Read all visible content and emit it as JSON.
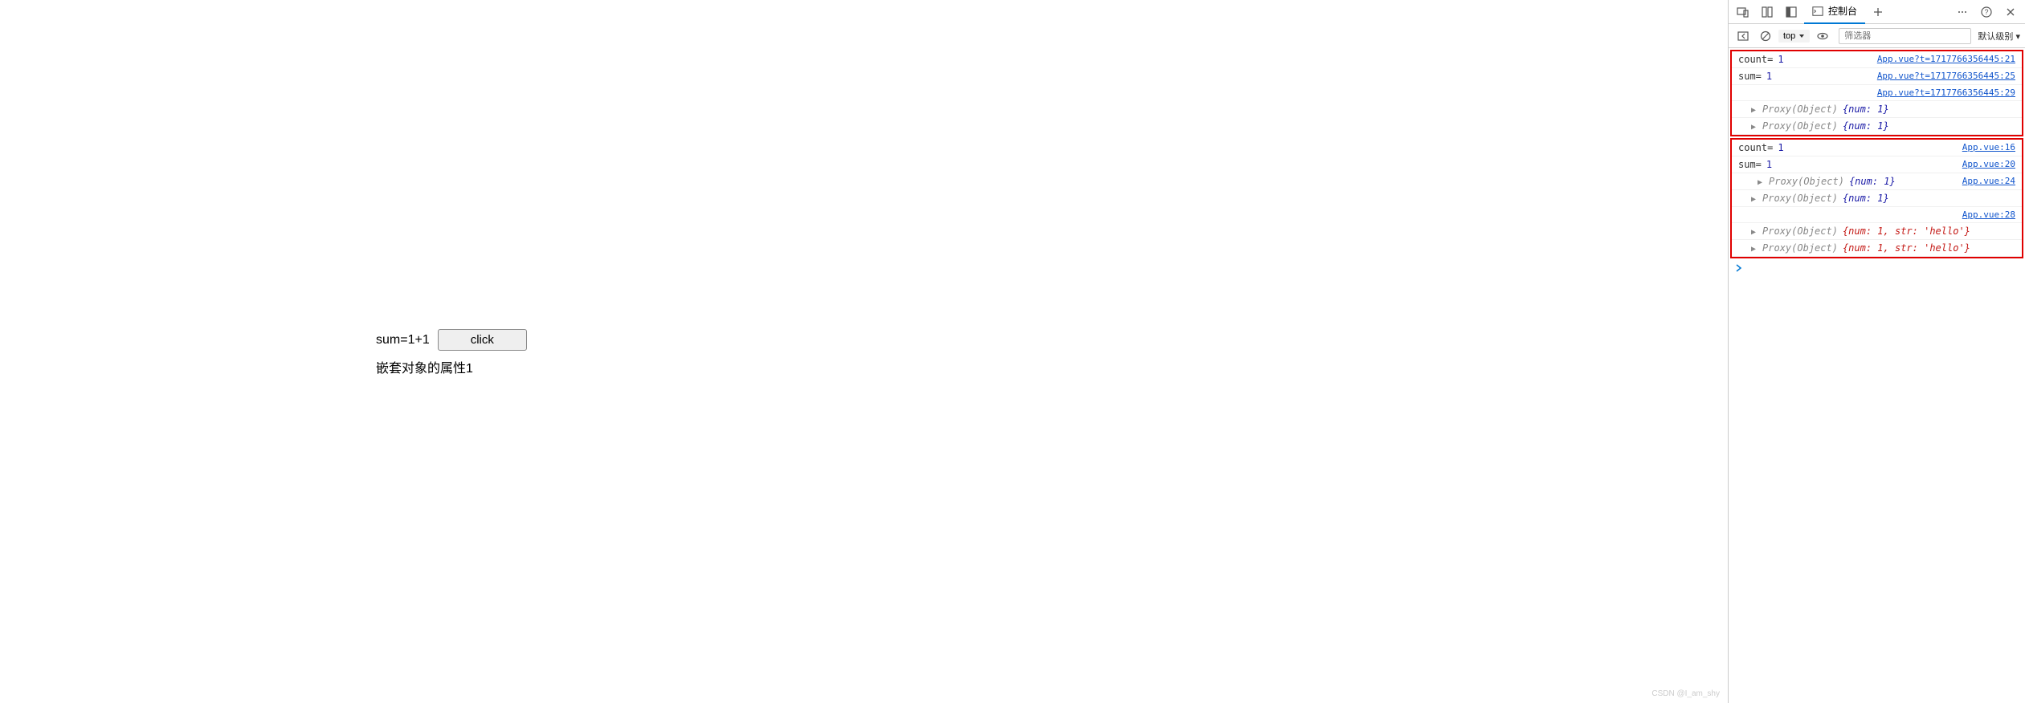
{
  "main": {
    "sum_line": "sum=1+1",
    "button_label": "click",
    "nested_line": "嵌套对象的属性1"
  },
  "devtools": {
    "tabs": {
      "console_label": "控制台"
    },
    "toolbar": {
      "context": "top",
      "filter_placeholder": "筛选器",
      "level": "默认级别"
    },
    "logs_group1": [
      {
        "label": "count=",
        "value": "1",
        "src": "App.vue?t=1717766356445:21"
      },
      {
        "label": "sum=",
        "value": "1",
        "src": "App.vue?t=1717766356445:25"
      }
    ],
    "group1_src3": "App.vue?t=1717766356445:29",
    "group1_proxy": [
      {
        "prefix": "Proxy(Object)",
        "body": "{num: 1}"
      },
      {
        "prefix": "Proxy(Object)",
        "body": "{num: 1}"
      }
    ],
    "logs_group2": [
      {
        "label": "count=",
        "value": "1",
        "src": "App.vue:16"
      },
      {
        "label": "sum=",
        "value": "1",
        "src": "App.vue:20"
      }
    ],
    "group2_proxy1_src": "App.vue:24",
    "group2_proxy1": [
      {
        "prefix": "Proxy(Object)",
        "body": "{num: 1}"
      },
      {
        "prefix": "Proxy(Object)",
        "body": "{num: 1}"
      }
    ],
    "group2_proxy2_src": "App.vue:28",
    "group2_proxy2": [
      {
        "prefix": "Proxy(Object)",
        "body": "{num: 1, str: 'hello'}"
      },
      {
        "prefix": "Proxy(Object)",
        "body": "{num: 1, str: 'hello'}"
      }
    ]
  },
  "watermark": "CSDN @I_am_shy"
}
